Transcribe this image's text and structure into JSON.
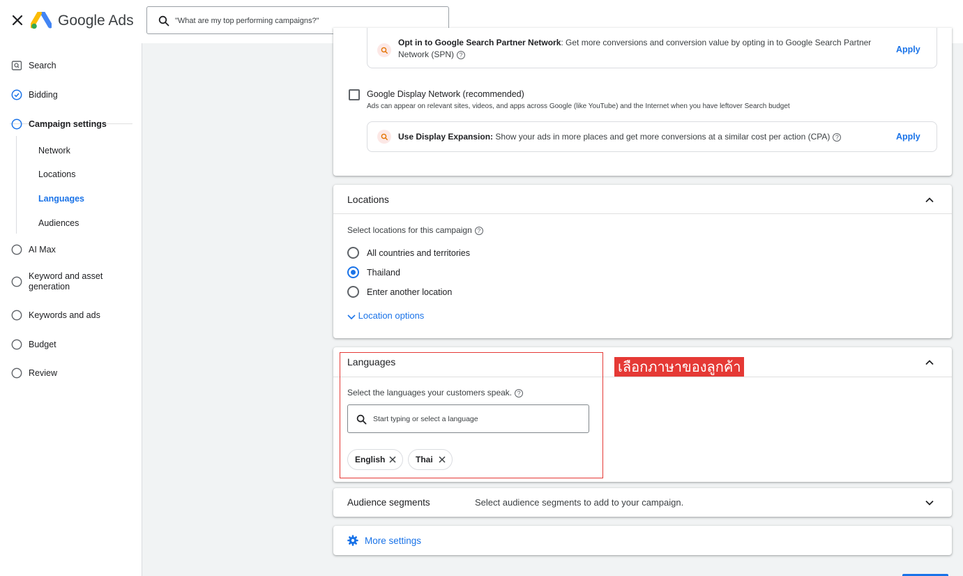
{
  "app": {
    "brand": "Google Ads",
    "search_placeholder": "\"What are my top performing campaigns?\""
  },
  "sidebar": {
    "items": [
      {
        "label": "Search",
        "icon": "search-box-icon"
      },
      {
        "label": "Bidding",
        "icon": "check-circle-icon"
      },
      {
        "label": "Campaign settings",
        "icon": "circle-icon"
      },
      {
        "label": "AI Max",
        "icon": "circle-icon"
      },
      {
        "label": "Keyword and asset generation",
        "icon": "circle-icon"
      },
      {
        "label": "Keywords and ads",
        "icon": "circle-icon"
      },
      {
        "label": "Budget",
        "icon": "circle-icon"
      },
      {
        "label": "Review",
        "icon": "circle-icon"
      }
    ],
    "sub_items": [
      "Network",
      "Locations",
      "Languages",
      "Audiences"
    ],
    "active_sub": "Languages"
  },
  "network": {
    "spn_title": "Opt in to Google Search Partner Network",
    "spn_text": ": Get more conversions and conversion value by opting in to Google Search Partner",
    "spn_text2": "Network (SPN)",
    "apply": "Apply",
    "gdn_label": "Google Display Network (recommended)",
    "gdn_desc": "Ads can appear on relevant sites, videos, and apps across Google (like YouTube) and the Internet when you have leftover Search budget",
    "display_title": "Use Display Expansion:",
    "display_text": "Show your ads in more places and get more conversions at a similar cost per action (CPA)"
  },
  "locations": {
    "title": "Locations",
    "prompt": "Select locations for this campaign",
    "options": [
      "All countries and territories",
      "Thailand",
      "Enter another location"
    ],
    "selected": "Thailand",
    "more": "Location options"
  },
  "languages": {
    "title": "Languages",
    "prompt": "Select the languages your customers speak.",
    "input_placeholder": "Start typing or select a language",
    "chips": [
      "English",
      "Thai"
    ],
    "annotation": "เลือกภาษาของลูกค้า"
  },
  "audience": {
    "title": "Audience segments",
    "desc": "Select audience segments to add to your campaign."
  },
  "more_settings": "More settings",
  "colors": {
    "accent": "#1a73e8",
    "annotation": "#e53935"
  }
}
